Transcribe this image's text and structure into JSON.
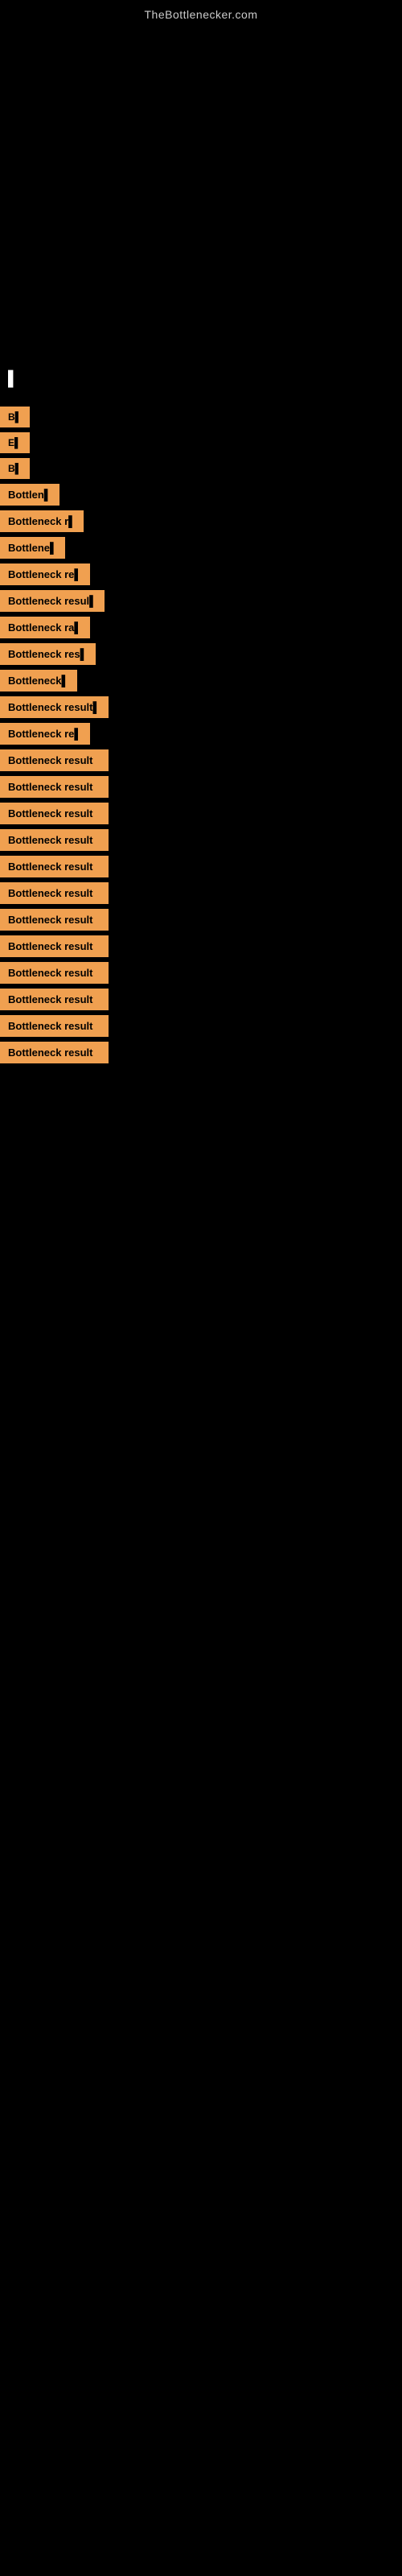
{
  "site": {
    "title": "TheBottlenecker.com"
  },
  "header_label": "▌",
  "rows": [
    {
      "label": "B▌",
      "size": "short"
    },
    {
      "label": "E▌",
      "size": "short"
    },
    {
      "label": "B▌",
      "size": "short"
    },
    {
      "label": "Bottlen▌",
      "size": "medium"
    },
    {
      "label": "Bottleneck r▌",
      "size": "medium"
    },
    {
      "label": "Bottlene▌",
      "size": "medium"
    },
    {
      "label": "Bottleneck re▌",
      "size": "medium"
    },
    {
      "label": "Bottleneck resul▌",
      "size": "long"
    },
    {
      "label": "Bottleneck ra▌",
      "size": "medium"
    },
    {
      "label": "Bottleneck res▌",
      "size": "long"
    },
    {
      "label": "Bottleneck▌",
      "size": "medium"
    },
    {
      "label": "Bottleneck result▌",
      "size": "long"
    },
    {
      "label": "Bottleneck re▌",
      "size": "long"
    },
    {
      "label": "Bottleneck result",
      "size": "full"
    },
    {
      "label": "Bottleneck result",
      "size": "full"
    },
    {
      "label": "Bottleneck result",
      "size": "full"
    },
    {
      "label": "Bottleneck result",
      "size": "full"
    },
    {
      "label": "Bottleneck result",
      "size": "full"
    },
    {
      "label": "Bottleneck result",
      "size": "full"
    },
    {
      "label": "Bottleneck result",
      "size": "full"
    },
    {
      "label": "Bottleneck result",
      "size": "full"
    },
    {
      "label": "Bottleneck result",
      "size": "full"
    },
    {
      "label": "Bottleneck result",
      "size": "full"
    },
    {
      "label": "Bottleneck result",
      "size": "full"
    },
    {
      "label": "Bottleneck result",
      "size": "full"
    }
  ]
}
